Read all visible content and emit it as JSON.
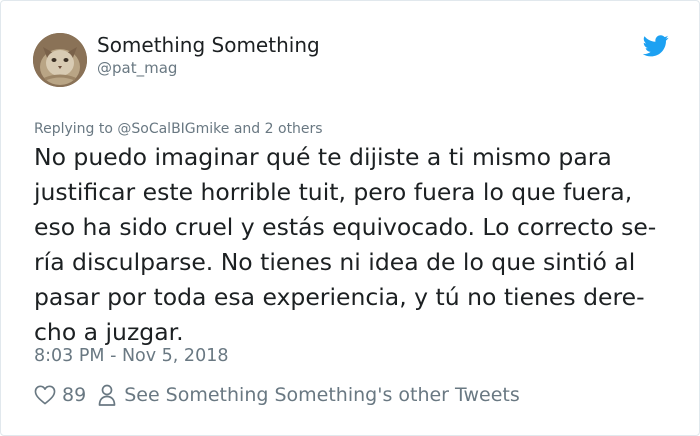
{
  "author": {
    "display_name": "Something Something",
    "handle": "@pat_mag",
    "avatar_icon": "cat-avatar"
  },
  "brand": {
    "icon": "twitter-bird-icon",
    "color": "#1da1f2"
  },
  "reply_context": "Replying to @SoCalBIGmike and 2 others",
  "tweet_lines": [
    "No puedo imaginar qué te dijiste a ti mismo para",
    "justificar este horrible tuit, pero fuera lo que fuera,",
    "eso ha sido cruel y estás equivocado. Lo correcto se-",
    "ría disculparse. No tienes ni idea de lo que sintió al",
    "pasar por toda esa experiencia, y tú no tienes dere-",
    "cho a juzgar."
  ],
  "timestamp": "8:03 PM - Nov 5, 2018",
  "likes": "89",
  "other_tweets_link": "See Something Something's other Tweets"
}
